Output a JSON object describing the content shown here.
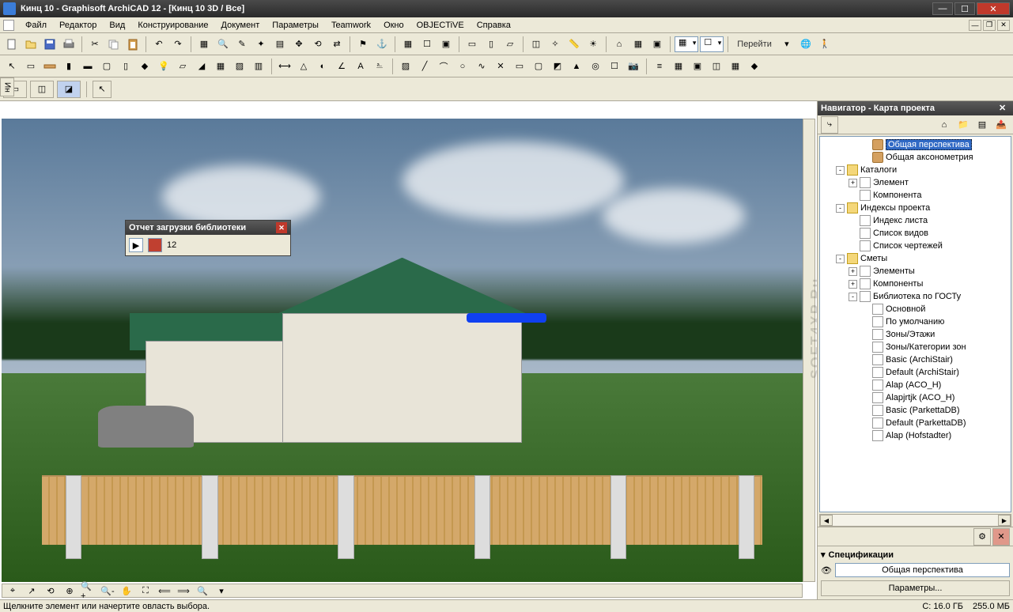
{
  "title": "Кинц 10 - Graphisoft ArchiCAD 12 - [Кинц 10 3D / Все]",
  "menus": [
    "Файл",
    "Редактор",
    "Вид",
    "Конструирование",
    "Документ",
    "Параметры",
    "Teamwork",
    "Окно",
    "OBJECTiVE",
    "Справка"
  ],
  "go_label": "Перейти",
  "report": {
    "title": "Отчет загрузки библиотеки",
    "count": "12"
  },
  "navigator": {
    "title": "Навигатор - Карта проекта",
    "selected": "Общая перспектива",
    "tree": [
      {
        "d": 3,
        "exp": "",
        "ic": "ic-cam",
        "t": "Общая перспектива",
        "sel": true
      },
      {
        "d": 3,
        "exp": "",
        "ic": "ic-cam",
        "t": "Общая аксонометрия"
      },
      {
        "d": 1,
        "exp": "-",
        "ic": "ic-folder",
        "t": "Каталоги"
      },
      {
        "d": 2,
        "exp": "+",
        "ic": "ic-doc",
        "t": "Элемент"
      },
      {
        "d": 2,
        "exp": "",
        "ic": "ic-doc",
        "t": "Компонента"
      },
      {
        "d": 1,
        "exp": "-",
        "ic": "ic-folder",
        "t": "Индексы проекта"
      },
      {
        "d": 2,
        "exp": "",
        "ic": "ic-doc",
        "t": "Индекс листа"
      },
      {
        "d": 2,
        "exp": "",
        "ic": "ic-doc",
        "t": "Список видов"
      },
      {
        "d": 2,
        "exp": "",
        "ic": "ic-doc",
        "t": "Список чертежей"
      },
      {
        "d": 1,
        "exp": "-",
        "ic": "ic-folder",
        "t": "Сметы"
      },
      {
        "d": 2,
        "exp": "+",
        "ic": "ic-doc",
        "t": "Элементы"
      },
      {
        "d": 2,
        "exp": "+",
        "ic": "ic-doc",
        "t": "Компоненты"
      },
      {
        "d": 2,
        "exp": "-",
        "ic": "ic-doc",
        "t": "Библиотека по ГОСТу"
      },
      {
        "d": 3,
        "exp": "",
        "ic": "ic-doc",
        "t": "Основной"
      },
      {
        "d": 3,
        "exp": "",
        "ic": "ic-doc",
        "t": "По умолчанию"
      },
      {
        "d": 3,
        "exp": "",
        "ic": "ic-doc",
        "t": "Зоны/Этажи"
      },
      {
        "d": 3,
        "exp": "",
        "ic": "ic-doc",
        "t": "Зоны/Категории зон"
      },
      {
        "d": 3,
        "exp": "",
        "ic": "ic-doc",
        "t": "Basic (ArchiStair)"
      },
      {
        "d": 3,
        "exp": "",
        "ic": "ic-doc",
        "t": "Default (ArchiStair)"
      },
      {
        "d": 3,
        "exp": "",
        "ic": "ic-doc",
        "t": "Alap (ACO_H)"
      },
      {
        "d": 3,
        "exp": "",
        "ic": "ic-doc",
        "t": "Alapjrtjk (ACO_H)"
      },
      {
        "d": 3,
        "exp": "",
        "ic": "ic-doc",
        "t": "Basic (ParkettaDB)"
      },
      {
        "d": 3,
        "exp": "",
        "ic": "ic-doc",
        "t": "Default (ParkettaDB)"
      },
      {
        "d": 3,
        "exp": "",
        "ic": "ic-doc",
        "t": "Alap (Hofstadter)"
      }
    ]
  },
  "spec": {
    "title": "Спецификации",
    "value": "Общая перспектива",
    "btn": "Параметры..."
  },
  "status": {
    "hint": "Щелкните элемент или начертите овласть выбора.",
    "disk": "C: 16.0 ГБ",
    "mem": "255.0 МБ"
  },
  "vtab": "Ин",
  "watermark": "SOFT4XP.Ru"
}
